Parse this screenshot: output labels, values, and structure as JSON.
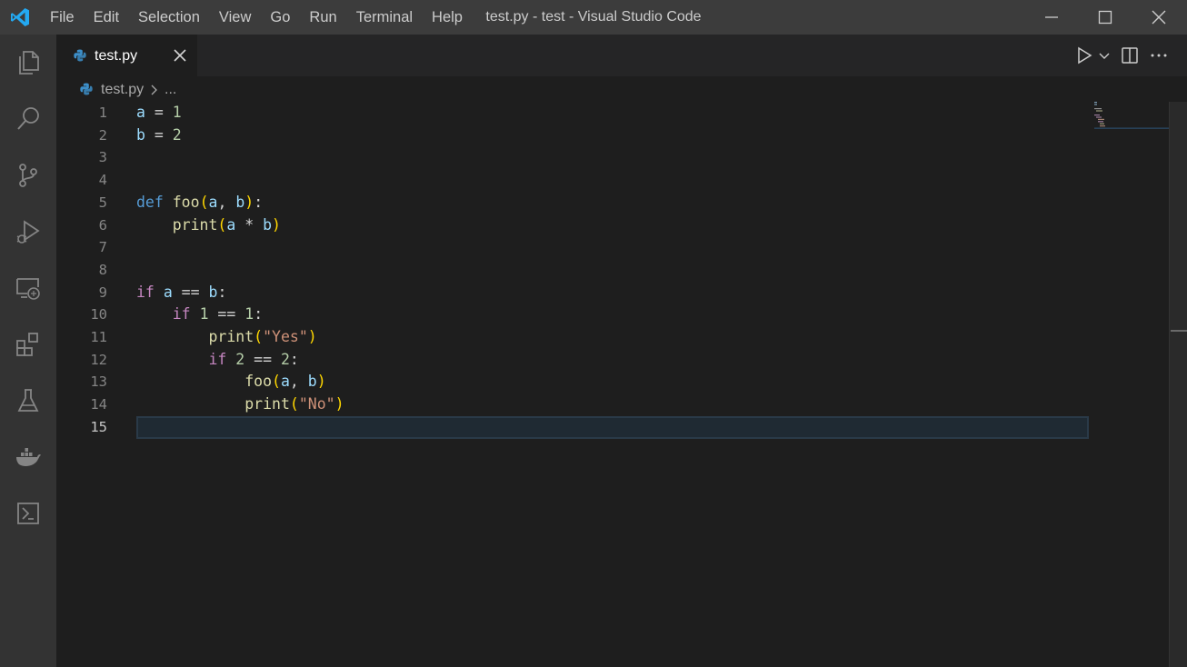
{
  "titlebar": {
    "menu": [
      "File",
      "Edit",
      "Selection",
      "View",
      "Go",
      "Run",
      "Terminal",
      "Help"
    ],
    "window_title": "test.py - test - Visual Studio Code"
  },
  "activity_bar": {
    "icons": [
      "explorer-icon",
      "search-icon",
      "source-control-icon",
      "run-debug-icon",
      "remote-explorer-icon",
      "extensions-icon",
      "testing-icon",
      "docker-icon",
      "powershell-icon"
    ]
  },
  "tabs": [
    {
      "label": "test.py",
      "active": true
    }
  ],
  "breadcrumb": {
    "file": "test.py",
    "more": "..."
  },
  "editor": {
    "active_line": 15,
    "lines": [
      {
        "n": "1",
        "tokens": [
          [
            "var",
            "a"
          ],
          [
            "op",
            " = "
          ],
          [
            "num",
            "1"
          ]
        ]
      },
      {
        "n": "2",
        "tokens": [
          [
            "var",
            "b"
          ],
          [
            "op",
            " = "
          ],
          [
            "num",
            "2"
          ]
        ]
      },
      {
        "n": "3",
        "tokens": []
      },
      {
        "n": "4",
        "tokens": []
      },
      {
        "n": "5",
        "tokens": [
          [
            "kw",
            "def"
          ],
          [
            "op",
            " "
          ],
          [
            "fn",
            "foo"
          ],
          [
            "br1",
            "("
          ],
          [
            "var",
            "a"
          ],
          [
            "op",
            ", "
          ],
          [
            "var",
            "b"
          ],
          [
            "br1",
            ")"
          ],
          [
            "op",
            ":"
          ]
        ]
      },
      {
        "n": "6",
        "tokens": [
          [
            "op",
            "    "
          ],
          [
            "fn",
            "print"
          ],
          [
            "br1",
            "("
          ],
          [
            "var",
            "a"
          ],
          [
            "op",
            " * "
          ],
          [
            "var",
            "b"
          ],
          [
            "br1",
            ")"
          ]
        ]
      },
      {
        "n": "7",
        "tokens": []
      },
      {
        "n": "8",
        "tokens": []
      },
      {
        "n": "9",
        "tokens": [
          [
            "ctrl",
            "if"
          ],
          [
            "op",
            " "
          ],
          [
            "var",
            "a"
          ],
          [
            "op",
            " == "
          ],
          [
            "var",
            "b"
          ],
          [
            "op",
            ":"
          ]
        ]
      },
      {
        "n": "10",
        "tokens": [
          [
            "op",
            "    "
          ],
          [
            "ctrl",
            "if"
          ],
          [
            "op",
            " "
          ],
          [
            "num",
            "1"
          ],
          [
            "op",
            " == "
          ],
          [
            "num",
            "1"
          ],
          [
            "op",
            ":"
          ]
        ]
      },
      {
        "n": "11",
        "tokens": [
          [
            "op",
            "        "
          ],
          [
            "fn",
            "print"
          ],
          [
            "br1",
            "("
          ],
          [
            "str",
            "\"Yes\""
          ],
          [
            "br1",
            ")"
          ]
        ]
      },
      {
        "n": "12",
        "tokens": [
          [
            "op",
            "        "
          ],
          [
            "ctrl",
            "if"
          ],
          [
            "op",
            " "
          ],
          [
            "num",
            "2"
          ],
          [
            "op",
            " == "
          ],
          [
            "num",
            "2"
          ],
          [
            "op",
            ":"
          ]
        ]
      },
      {
        "n": "13",
        "tokens": [
          [
            "op",
            "            "
          ],
          [
            "fn",
            "foo"
          ],
          [
            "br1",
            "("
          ],
          [
            "var",
            "a"
          ],
          [
            "op",
            ", "
          ],
          [
            "var",
            "b"
          ],
          [
            "br1",
            ")"
          ]
        ]
      },
      {
        "n": "14",
        "tokens": [
          [
            "op",
            "            "
          ],
          [
            "fn",
            "print"
          ],
          [
            "br1",
            "("
          ],
          [
            "str",
            "\"No\""
          ],
          [
            "br1",
            ")"
          ]
        ]
      },
      {
        "n": "15",
        "tokens": []
      }
    ]
  },
  "colors": {
    "titlebar_bg": "#3c3c3c",
    "activitybar_bg": "#333333",
    "editor_bg": "#1e1e1e",
    "tabsbar_bg": "#252526",
    "vscode_blue": "#23a9f2"
  }
}
